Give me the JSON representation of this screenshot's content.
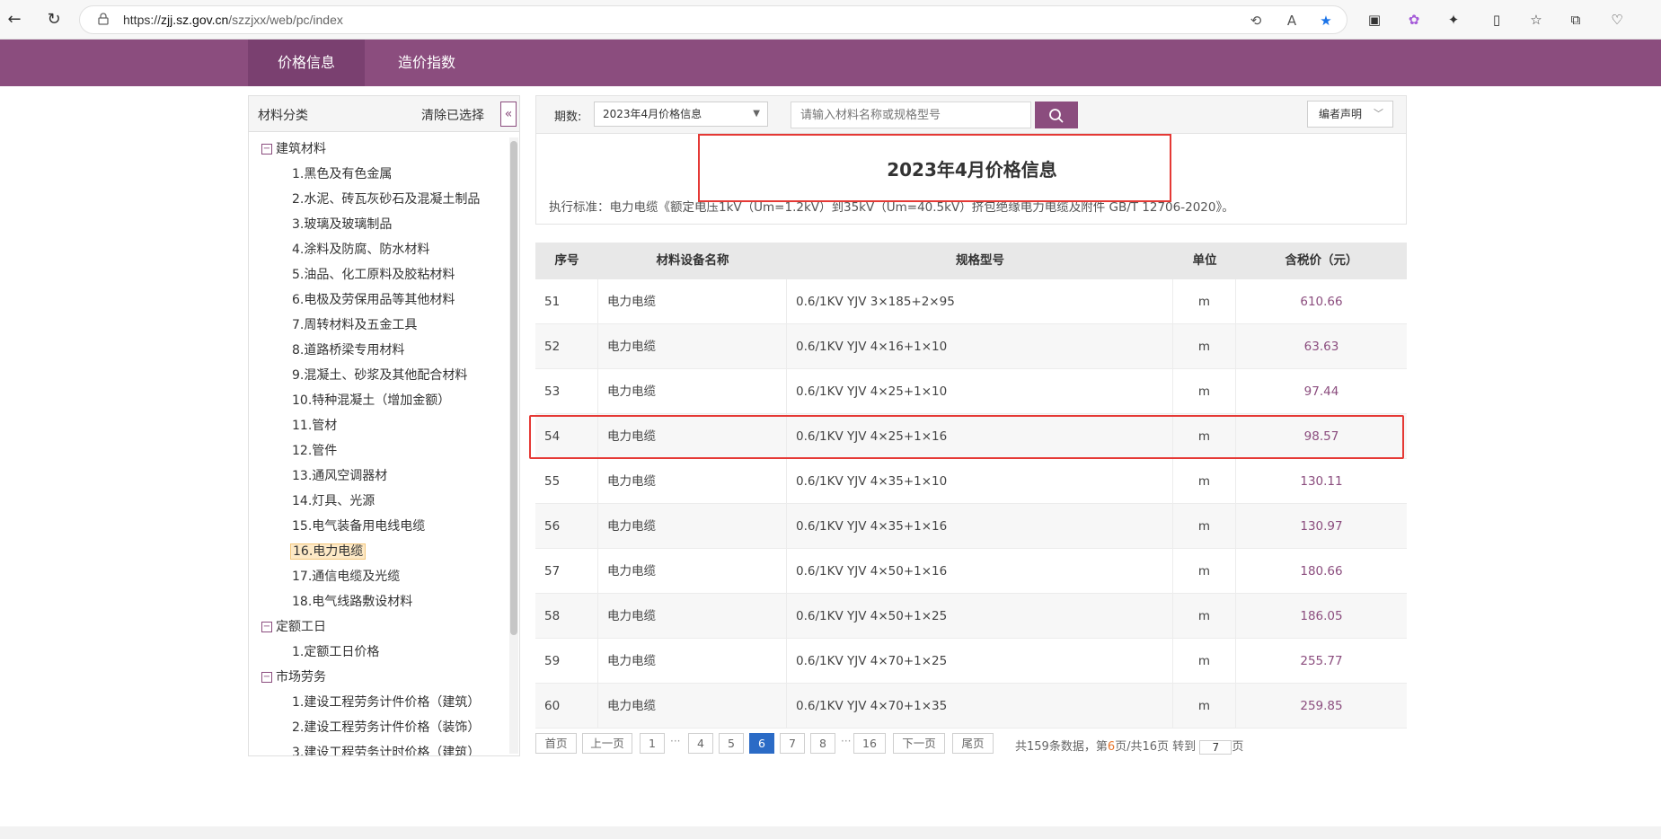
{
  "browser": {
    "url_prefix": "https://",
    "url_host": "zjj.sz.gov.cn",
    "url_path": "/szzjxx/web/pc/index"
  },
  "header": {
    "tabs": [
      {
        "label": "价格信息"
      },
      {
        "label": "造价指数"
      }
    ]
  },
  "sidebar": {
    "title": "材料分类",
    "clear_label": "清除已选择",
    "collapse_glyph": "«",
    "groups": [
      {
        "label": "建筑材料",
        "items": [
          "1.黑色及有色金属",
          "2.水泥、砖瓦灰砂石及混凝土制品",
          "3.玻璃及玻璃制品",
          "4.涂料及防腐、防水材料",
          "5.油品、化工原料及胶粘材料",
          "6.电极及劳保用品等其他材料",
          "7.周转材料及五金工具",
          "8.道路桥梁专用材料",
          "9.混凝土、砂浆及其他配合材料",
          "10.特种混凝土（增加金额）",
          "11.管材",
          "12.管件",
          "13.通风空调器材",
          "14.灯具、光源",
          "15.电气装备用电线电缆",
          "16.电力电缆",
          "17.通信电缆及光缆",
          "18.电气线路敷设材料"
        ]
      },
      {
        "label": "定额工日",
        "items": [
          "1.定额工日价格"
        ]
      },
      {
        "label": "市场劳务",
        "items": [
          "1.建设工程劳务计件价格（建筑）",
          "2.建设工程劳务计件价格（装饰）",
          "3.建设工程劳务计时价格（建筑）"
        ]
      }
    ],
    "selected_item": "16.电力电缆"
  },
  "toolbar": {
    "period_label": "期数:",
    "period_value": "2023年4月价格信息",
    "search_placeholder": "请输入材料名称或规格型号",
    "editor_note": "编者声明"
  },
  "info": {
    "title": "2023年4月价格信息",
    "standard": "执行标准：电力电缆《额定电压1kV（Um=1.2kV）到35kV（Um=40.5kV）挤包绝缘电力电缆及附件 GB/T 12706-2020》。"
  },
  "table": {
    "headers": [
      "序号",
      "材料设备名称",
      "规格型号",
      "单位",
      "含税价（元）"
    ],
    "rows": [
      {
        "no": "51",
        "name": "电力电缆",
        "spec": "0.6/1KV YJV 3×185+2×95",
        "unit": "m",
        "price": "610.66"
      },
      {
        "no": "52",
        "name": "电力电缆",
        "spec": "0.6/1KV YJV 4×16+1×10",
        "unit": "m",
        "price": "63.63"
      },
      {
        "no": "53",
        "name": "电力电缆",
        "spec": "0.6/1KV YJV 4×25+1×10",
        "unit": "m",
        "price": "97.44"
      },
      {
        "no": "54",
        "name": "电力电缆",
        "spec": "0.6/1KV YJV 4×25+1×16",
        "unit": "m",
        "price": "98.57"
      },
      {
        "no": "55",
        "name": "电力电缆",
        "spec": "0.6/1KV YJV 4×35+1×10",
        "unit": "m",
        "price": "130.11"
      },
      {
        "no": "56",
        "name": "电力电缆",
        "spec": "0.6/1KV YJV 4×35+1×16",
        "unit": "m",
        "price": "130.97"
      },
      {
        "no": "57",
        "name": "电力电缆",
        "spec": "0.6/1KV YJV 4×50+1×16",
        "unit": "m",
        "price": "180.66"
      },
      {
        "no": "58",
        "name": "电力电缆",
        "spec": "0.6/1KV YJV 4×50+1×25",
        "unit": "m",
        "price": "186.05"
      },
      {
        "no": "59",
        "name": "电力电缆",
        "spec": "0.6/1KV YJV 4×70+1×25",
        "unit": "m",
        "price": "255.77"
      },
      {
        "no": "60",
        "name": "电力电缆",
        "spec": "0.6/1KV YJV 4×70+1×35",
        "unit": "m",
        "price": "259.85"
      }
    ]
  },
  "pager": {
    "first": "首页",
    "prev": "上一页",
    "pages": [
      "1",
      "4",
      "5",
      "6",
      "7",
      "8",
      "16"
    ],
    "dots": "···",
    "active": "6",
    "next": "下一页",
    "last": "尾页",
    "info_prefix": "共159条数据，第",
    "info_page": "6",
    "info_suffix": "页/共16页 转到",
    "jump_value": "7",
    "jump_suffix": "页"
  },
  "colors": {
    "brand": "#8b4d7e",
    "highlight": "#e53935",
    "active_page": "#2b6bc6"
  }
}
